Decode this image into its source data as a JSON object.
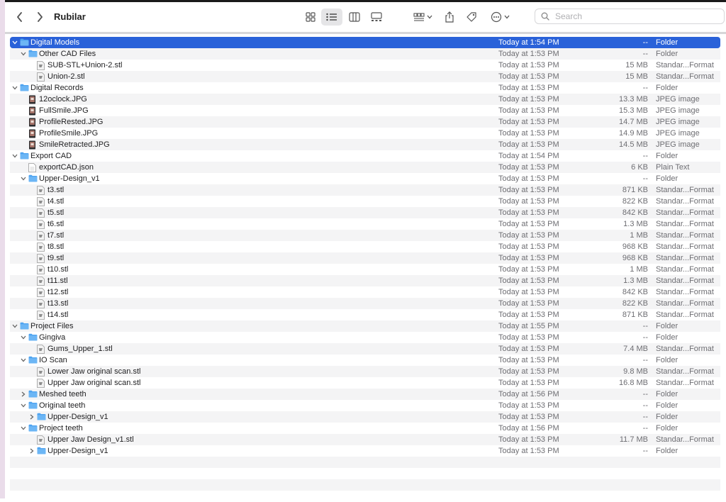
{
  "window": {
    "title": "Rubilar"
  },
  "search": {
    "placeholder": "Search"
  },
  "rows": [
    {
      "name": "Digital Models",
      "date": "Today at 1:54 PM",
      "size": "--",
      "kind": "Folder",
      "icon": "folder-icon",
      "level": 0,
      "disc": "open",
      "selected": true
    },
    {
      "name": "Other CAD Files",
      "date": "Today at 1:53 PM",
      "size": "--",
      "kind": "Folder",
      "icon": "folder-icon",
      "level": 1,
      "disc": "open"
    },
    {
      "name": "SUB-STL+Union-2.stl",
      "date": "Today at 1:53 PM",
      "size": "15 MB",
      "kind": "Standar...Format",
      "icon": "stl-file-icon",
      "level": 2
    },
    {
      "name": "Union-2.stl",
      "date": "Today at 1:53 PM",
      "size": "15 MB",
      "kind": "Standar...Format",
      "icon": "stl-file-icon",
      "level": 2
    },
    {
      "name": "Digital Records",
      "date": "Today at 1:53 PM",
      "size": "--",
      "kind": "Folder",
      "icon": "folder-icon",
      "level": 0,
      "disc": "open"
    },
    {
      "name": "12oclock.JPG",
      "date": "Today at 1:53 PM",
      "size": "13.3 MB",
      "kind": "JPEG image",
      "icon": "image-icon",
      "level": 1
    },
    {
      "name": "FullSmile.JPG",
      "date": "Today at 1:53 PM",
      "size": "15.3 MB",
      "kind": "JPEG image",
      "icon": "image-icon",
      "level": 1
    },
    {
      "name": "ProfileRested.JPG",
      "date": "Today at 1:53 PM",
      "size": "14.7 MB",
      "kind": "JPEG image",
      "icon": "image-icon",
      "level": 1
    },
    {
      "name": "ProfileSmile.JPG",
      "date": "Today at 1:53 PM",
      "size": "14.9 MB",
      "kind": "JPEG image",
      "icon": "image-icon",
      "level": 1
    },
    {
      "name": "SmileRetracted.JPG",
      "date": "Today at 1:53 PM",
      "size": "14.5 MB",
      "kind": "JPEG image",
      "icon": "image-icon",
      "level": 1
    },
    {
      "name": "Export CAD",
      "date": "Today at 1:54 PM",
      "size": "--",
      "kind": "Folder",
      "icon": "folder-icon",
      "level": 0,
      "disc": "open"
    },
    {
      "name": "exportCAD.json",
      "date": "Today at 1:53 PM",
      "size": "6 KB",
      "kind": "Plain Text",
      "icon": "text-file-icon",
      "level": 1
    },
    {
      "name": "Upper-Design_v1",
      "date": "Today at 1:53 PM",
      "size": "--",
      "kind": "Folder",
      "icon": "folder-icon",
      "level": 1,
      "disc": "open"
    },
    {
      "name": "t3.stl",
      "date": "Today at 1:53 PM",
      "size": "871 KB",
      "kind": "Standar...Format",
      "icon": "stl-file-icon",
      "level": 2
    },
    {
      "name": "t4.stl",
      "date": "Today at 1:53 PM",
      "size": "822 KB",
      "kind": "Standar...Format",
      "icon": "stl-file-icon",
      "level": 2
    },
    {
      "name": "t5.stl",
      "date": "Today at 1:53 PM",
      "size": "842 KB",
      "kind": "Standar...Format",
      "icon": "stl-file-icon",
      "level": 2
    },
    {
      "name": "t6.stl",
      "date": "Today at 1:53 PM",
      "size": "1.3 MB",
      "kind": "Standar...Format",
      "icon": "stl-file-icon",
      "level": 2
    },
    {
      "name": "t7.stl",
      "date": "Today at 1:53 PM",
      "size": "1 MB",
      "kind": "Standar...Format",
      "icon": "stl-file-icon",
      "level": 2
    },
    {
      "name": "t8.stl",
      "date": "Today at 1:53 PM",
      "size": "968 KB",
      "kind": "Standar...Format",
      "icon": "stl-file-icon",
      "level": 2
    },
    {
      "name": "t9.stl",
      "date": "Today at 1:53 PM",
      "size": "968 KB",
      "kind": "Standar...Format",
      "icon": "stl-file-icon",
      "level": 2
    },
    {
      "name": "t10.stl",
      "date": "Today at 1:53 PM",
      "size": "1 MB",
      "kind": "Standar...Format",
      "icon": "stl-file-icon",
      "level": 2
    },
    {
      "name": "t11.stl",
      "date": "Today at 1:53 PM",
      "size": "1.3 MB",
      "kind": "Standar...Format",
      "icon": "stl-file-icon",
      "level": 2
    },
    {
      "name": "t12.stl",
      "date": "Today at 1:53 PM",
      "size": "842 KB",
      "kind": "Standar...Format",
      "icon": "stl-file-icon",
      "level": 2
    },
    {
      "name": "t13.stl",
      "date": "Today at 1:53 PM",
      "size": "822 KB",
      "kind": "Standar...Format",
      "icon": "stl-file-icon",
      "level": 2
    },
    {
      "name": "t14.stl",
      "date": "Today at 1:53 PM",
      "size": "871 KB",
      "kind": "Standar...Format",
      "icon": "stl-file-icon",
      "level": 2
    },
    {
      "name": "Project Files",
      "date": "Today at 1:55 PM",
      "size": "--",
      "kind": "Folder",
      "icon": "folder-icon",
      "level": 0,
      "disc": "open"
    },
    {
      "name": "Gingiva",
      "date": "Today at 1:53 PM",
      "size": "--",
      "kind": "Folder",
      "icon": "folder-icon",
      "level": 1,
      "disc": "open"
    },
    {
      "name": "Gums_Upper_1.stl",
      "date": "Today at 1:53 PM",
      "size": "7.4 MB",
      "kind": "Standar...Format",
      "icon": "stl-file-icon",
      "level": 2
    },
    {
      "name": "IO Scan",
      "date": "Today at 1:53 PM",
      "size": "--",
      "kind": "Folder",
      "icon": "folder-icon",
      "level": 1,
      "disc": "open"
    },
    {
      "name": "Lower Jaw original scan.stl",
      "date": "Today at 1:53 PM",
      "size": "9.8 MB",
      "kind": "Standar...Format",
      "icon": "stl-file-icon",
      "level": 2
    },
    {
      "name": "Upper Jaw original scan.stl",
      "date": "Today at 1:53 PM",
      "size": "16.8 MB",
      "kind": "Standar...Format",
      "icon": "stl-file-icon",
      "level": 2
    },
    {
      "name": "Meshed teeth",
      "date": "Today at 1:56 PM",
      "size": "--",
      "kind": "Folder",
      "icon": "folder-icon",
      "level": 1,
      "disc": "closed"
    },
    {
      "name": "Original teeth",
      "date": "Today at 1:53 PM",
      "size": "--",
      "kind": "Folder",
      "icon": "folder-icon",
      "level": 1,
      "disc": "open"
    },
    {
      "name": "Upper-Design_v1",
      "date": "Today at 1:53 PM",
      "size": "--",
      "kind": "Folder",
      "icon": "folder-icon",
      "level": 2,
      "disc": "closed"
    },
    {
      "name": "Project teeth",
      "date": "Today at 1:56 PM",
      "size": "--",
      "kind": "Folder",
      "icon": "folder-icon",
      "level": 1,
      "disc": "open"
    },
    {
      "name": "Upper Jaw Design_v1.stl",
      "date": "Today at 1:53 PM",
      "size": "11.7 MB",
      "kind": "Standar...Format",
      "icon": "stl-file-icon",
      "level": 2
    },
    {
      "name": "Upper-Design_v1",
      "date": "Today at 1:53 PM",
      "size": "--",
      "kind": "Folder",
      "icon": "folder-icon",
      "level": 2,
      "disc": "closed"
    }
  ],
  "empty_rows": 4,
  "colors": {
    "selection": "#2a62d9",
    "folder": "#4ea3f0",
    "stripe": "#f4f4f5"
  }
}
